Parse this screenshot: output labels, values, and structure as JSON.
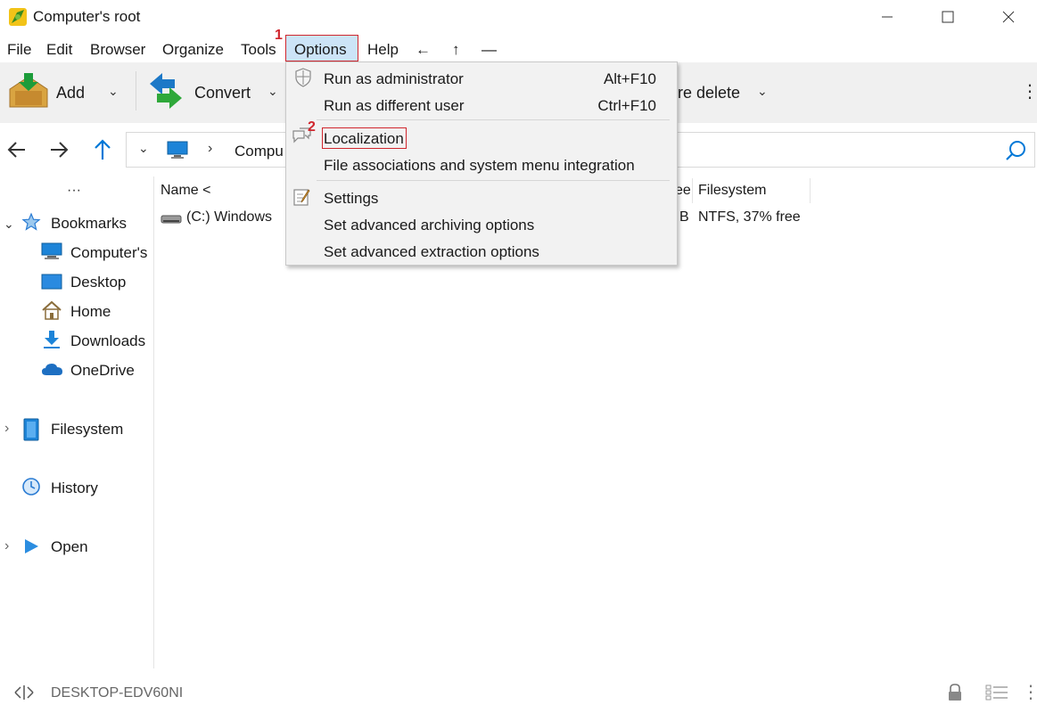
{
  "window": {
    "title": "Computer's root"
  },
  "menubar": {
    "items": [
      "File",
      "Edit",
      "Browser",
      "Organize",
      "Tools",
      "Options",
      "Help"
    ],
    "back_arrow": "←",
    "up_arrow": "↑",
    "dash": "—",
    "marker_1": "1"
  },
  "toolbar": {
    "add_label": "Add",
    "convert_label": "Convert",
    "delete_label": "re delete"
  },
  "address": {
    "path_partial": "Compu"
  },
  "sidebar": {
    "more": "···",
    "bookmarks_label": "Bookmarks",
    "bookmarks": [
      "Computer's",
      "Desktop",
      "Home",
      "Downloads",
      "OneDrive"
    ],
    "filesystem_label": "Filesystem",
    "history_label": "History",
    "open_label": "Open"
  },
  "filelist": {
    "headers": {
      "name": "Name <",
      "free_partial": "ee",
      "filesystem": "Filesystem"
    },
    "rows": [
      {
        "name": "(C:) Windows",
        "free_partial": "B",
        "filesystem": "NTFS, 37% free"
      }
    ]
  },
  "options_menu": {
    "marker_2": "2",
    "items": [
      {
        "label": "Run as administrator",
        "shortcut": "Alt+F10"
      },
      {
        "label": "Run as different user",
        "shortcut": "Ctrl+F10"
      },
      {
        "label": "Localization"
      },
      {
        "label": "File associations and system menu integration"
      },
      {
        "label": "Settings"
      },
      {
        "label": "Set advanced archiving options"
      },
      {
        "label": "Set advanced extraction options"
      }
    ]
  },
  "statusbar": {
    "computer_name": "DESKTOP-EDV60NI"
  },
  "colors": {
    "highlight_border": "#d0262d",
    "menu_active_bg": "#cce4f7",
    "accent_blue": "#0078d7",
    "toolbar_bg": "#f0f0f0"
  }
}
